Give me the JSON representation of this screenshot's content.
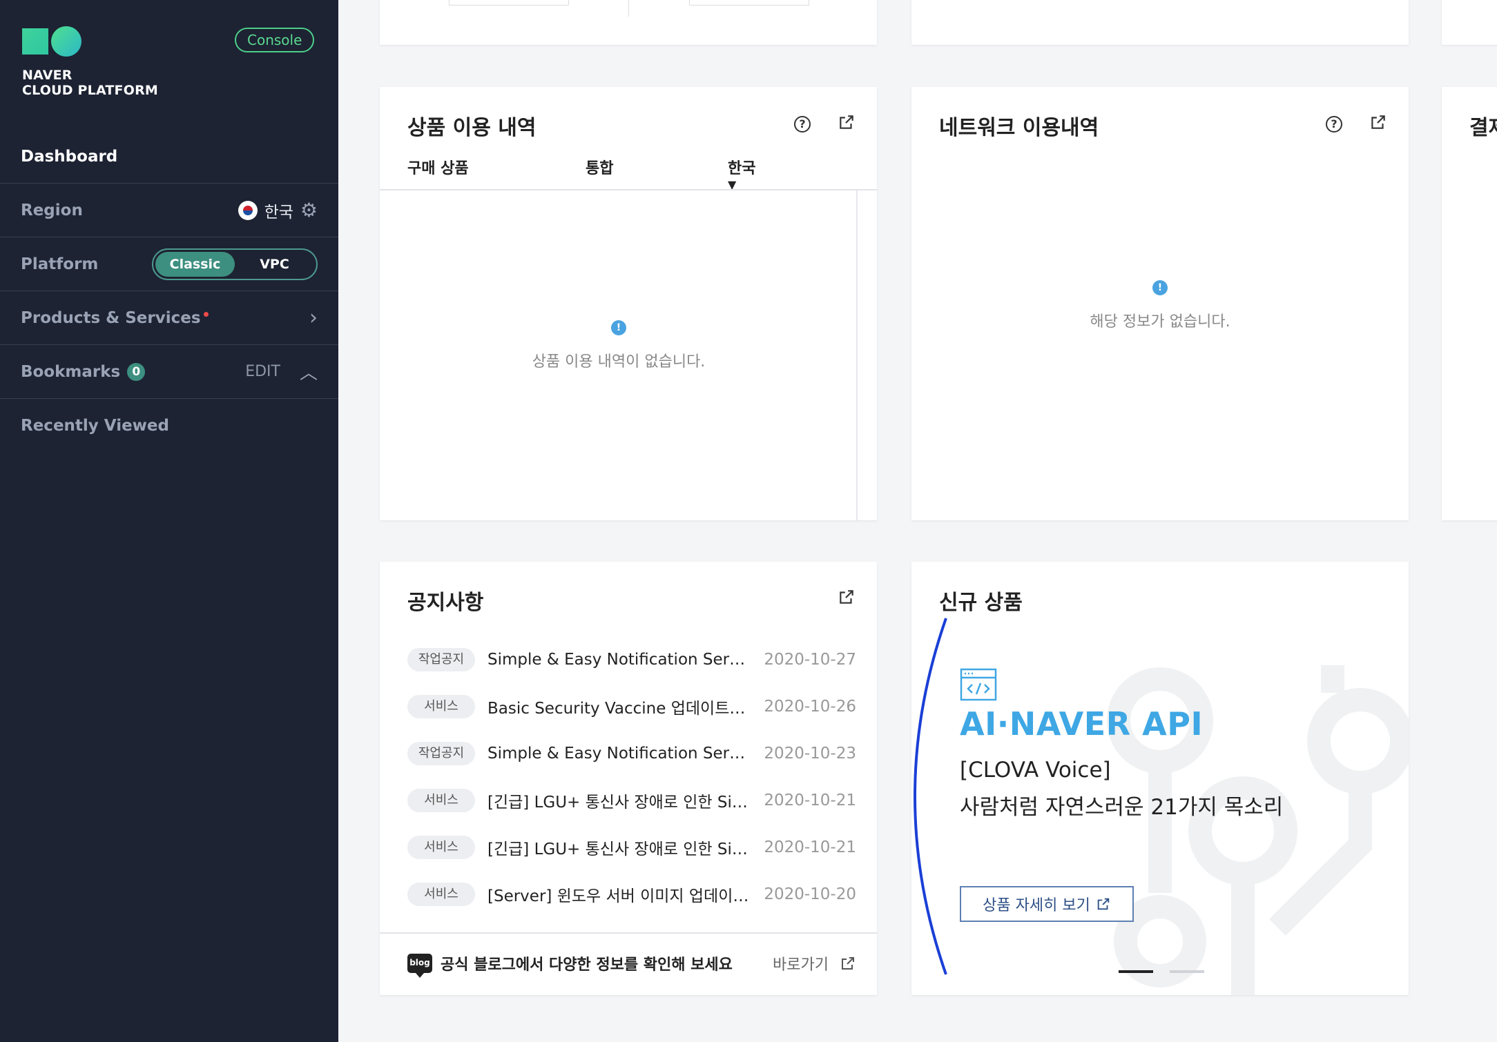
{
  "sidebar": {
    "logo_text_1": "NAVER",
    "logo_text_2": "CLOUD PLATFORM",
    "console_label": "Console",
    "dashboard_label": "Dashboard",
    "region_label": "Region",
    "region_value": "한국",
    "platform_label": "Platform",
    "platform_options": [
      "Classic",
      "VPC"
    ],
    "platform_selected": "Classic",
    "products_label": "Products & Services",
    "bookmarks_label": "Bookmarks",
    "bookmarks_count": "0",
    "bookmarks_edit": "EDIT",
    "recent_label": "Recently Viewed"
  },
  "usage_card": {
    "title": "상품 이용 내역",
    "tabs": [
      "구매 상품",
      "통합",
      "한국"
    ],
    "empty_text": "상품 이용 내역이 없습니다."
  },
  "network_card": {
    "title": "네트워크 이용내역",
    "empty_text": "해당 정보가 없습니다."
  },
  "right_stub": {
    "title": "결제"
  },
  "notice_card": {
    "title": "공지사항",
    "items": [
      {
        "tag": "작업공지",
        "title": "Simple & Easy Notification Service...",
        "date": "2020-10-27"
      },
      {
        "tag": "서비스",
        "title": "Basic Security Vaccine 업데이트 요...",
        "date": "2020-10-26"
      },
      {
        "tag": "작업공지",
        "title": "Simple & Easy Notification Service...",
        "date": "2020-10-23"
      },
      {
        "tag": "서비스",
        "title": "[긴급] LGU+ 통신사 장애로 인한 Simp...",
        "date": "2020-10-21"
      },
      {
        "tag": "서비스",
        "title": "[긴급] LGU+ 통신사 장애로 인한 Simp...",
        "date": "2020-10-21"
      },
      {
        "tag": "서비스",
        "title": "[Server] 윈도우 서버 이미지 업데이트 ...",
        "date": "2020-10-20"
      }
    ],
    "blog_icon_text": "blog",
    "blog_text": "공식 블로그에서 다양한 정보를 확인해 보세요",
    "blog_link": "바로가기"
  },
  "new_card": {
    "title": "신규 상품",
    "brand": "AI·NAVER API",
    "sub1": "[CLOVA Voice]",
    "sub2": "사람처럼 자연스러운 21가지 목소리",
    "detail_button": "상품 자세히 보기",
    "pager_active": 1,
    "pager_total": 2
  },
  "colors": {
    "sidebar_bg": "#1d2333",
    "accent_green": "#3d8f80",
    "console_green": "#4ccf8a",
    "brand_blue": "#3ea7e4",
    "info_blue": "#4aa3e0"
  }
}
